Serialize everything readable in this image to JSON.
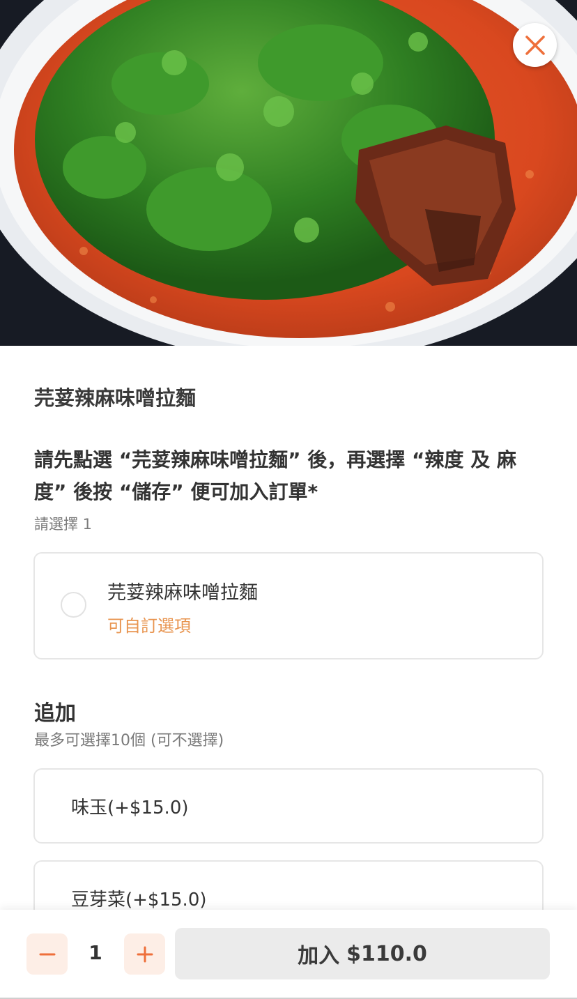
{
  "hero": {
    "image": "spicy-miso-ramen-with-coriander-photo",
    "close_icon": "close-icon"
  },
  "item": {
    "title": "芫荽辣麻味噌拉麵"
  },
  "section_main": {
    "instruction": "請先點選 “芫荽辣麻味噌拉麵” 後，再選擇 “辣度 及 麻度” 後按 “儲存” 便可加入訂單*",
    "requirement": "請選擇 1",
    "option": {
      "name": "芫荽辣麻味噌拉麵",
      "subtitle": "可自訂選項",
      "selected": false
    }
  },
  "section_addons": {
    "title": "追加",
    "requirement": "最多可選擇10個 (可不選擇)",
    "items": [
      {
        "label": "味玉(+$15.0)"
      },
      {
        "label": "豆芽菜(+$15.0)"
      }
    ]
  },
  "footer": {
    "quantity": "1",
    "minus_icon": "minus-icon",
    "plus_icon": "plus-icon",
    "add_label": "加入",
    "add_price": "$110.0"
  },
  "colors": {
    "accent": "#ee6f3a",
    "accent_light": "#fdeee6",
    "customizable_text": "#e8944f",
    "border": "#e6e6e6",
    "button_disabled": "#ebebeb"
  }
}
